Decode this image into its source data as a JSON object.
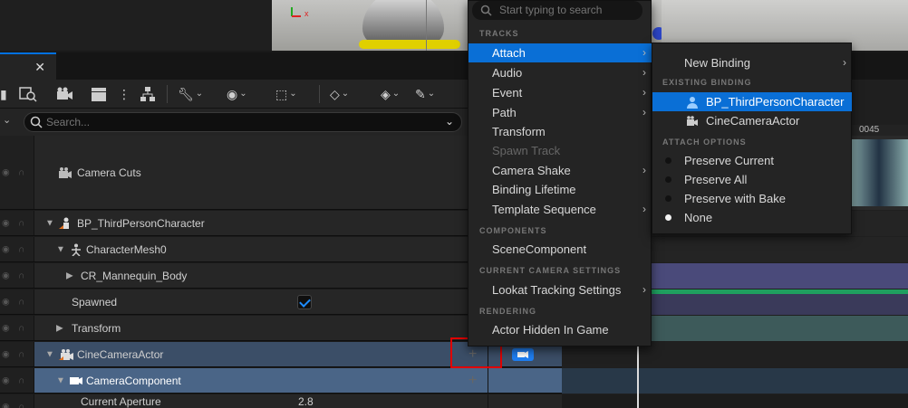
{
  "menu_search": {
    "placeholder": "Start typing to search"
  },
  "sequencer": {
    "search_placeholder": "Search...",
    "rows": {
      "camera_cuts": "Camera Cuts",
      "bp_third_person": "BP_ThirdPersonCharacter",
      "character_mesh": "CharacterMesh0",
      "mannequin_body": "CR_Mannequin_Body",
      "spawned": "Spawned",
      "transform": "Transform",
      "cine_camera_actor": "CineCameraActor",
      "camera_component": "CameraComponent",
      "current_aperture": "Current Aperture",
      "current_aperture_value": "2.8"
    },
    "timeline": {
      "frame_label": "0045"
    }
  },
  "track_menu": {
    "sections": {
      "tracks": "TRACKS",
      "components": "COMPONENTS",
      "current_camera_settings": "CURRENT CAMERA SETTINGS",
      "rendering": "RENDERING"
    },
    "items": {
      "attach": "Attach",
      "audio": "Audio",
      "event": "Event",
      "path": "Path",
      "transform": "Transform",
      "spawn_track": "Spawn Track",
      "camera_shake": "Camera Shake",
      "binding_lifetime": "Binding Lifetime",
      "template_sequence": "Template Sequence",
      "scene_component": "SceneComponent",
      "lookat_tracking": "Lookat Tracking Settings",
      "actor_hidden": "Actor Hidden In Game"
    }
  },
  "attach_menu": {
    "new_binding": "New Binding",
    "sections": {
      "existing_binding": "EXISTING BINDING",
      "attach_options": "ATTACH OPTIONS"
    },
    "bindings": {
      "bp_third_person": "BP_ThirdPersonCharacter",
      "cine_camera": "CineCameraActor"
    },
    "options": {
      "preserve_current": "Preserve Current",
      "preserve_all": "Preserve All",
      "preserve_bake": "Preserve with Bake",
      "none": "None"
    },
    "selected_option": "None"
  },
  "colors": {
    "accent": "#0a6fd6",
    "selected_row": "#3b4e67",
    "highlight_box": "#e00000"
  }
}
